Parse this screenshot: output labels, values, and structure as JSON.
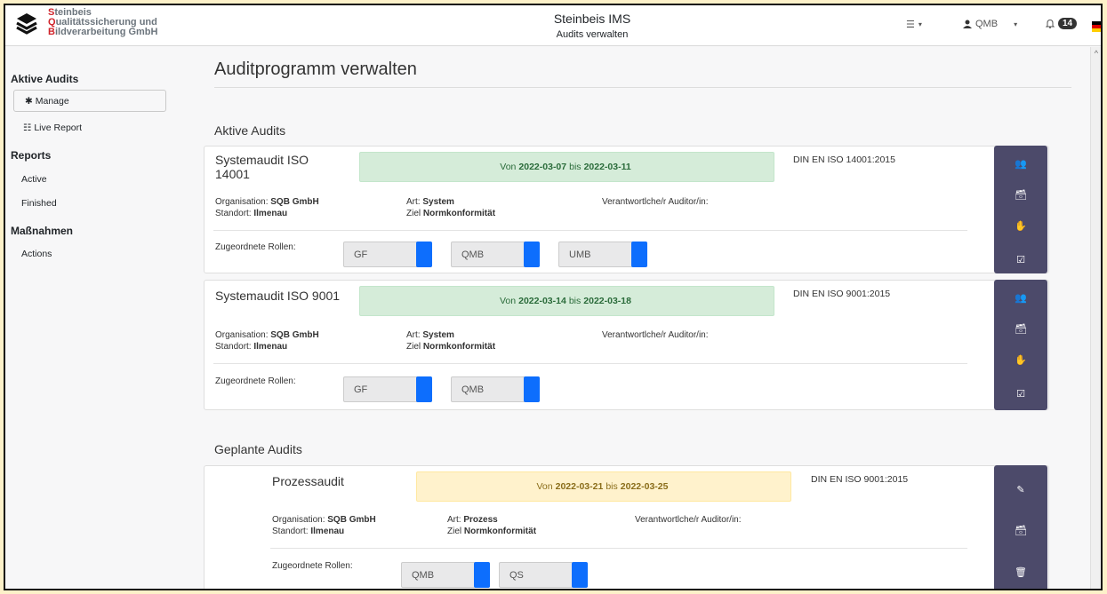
{
  "header": {
    "company_line1_init": "S",
    "company_line1_rest": "teinbeis",
    "company_line2_init": "Q",
    "company_line2_rest": "ualitätssicherung und",
    "company_line3_init": "B",
    "company_line3_rest": "ildverarbeitung GmbH",
    "app_title": "Steinbeis IMS",
    "app_subtitle": "Audits verwalten",
    "user": "QMB",
    "notifications": "14"
  },
  "sidebar": {
    "section1": "Aktive Audits",
    "manage": "Manage",
    "live_report": "Live Report",
    "section2": "Reports",
    "active": "Active",
    "finished": "Finished",
    "section3": "Maßnahmen",
    "actions": "Actions"
  },
  "main": {
    "page_title": "Auditprogramm verwalten",
    "active_title": "Aktive Audits",
    "planned_title": "Geplante Audits",
    "labels": {
      "von": "Von",
      "bis": "bis",
      "org": "Organisation:",
      "standort": "Standort:",
      "art": "Art:",
      "ziel": "Ziel",
      "verantwortlich": "Verantwortlche/r Auditor/in:",
      "roles": "Zugeordnete Rollen:"
    },
    "active_audits": [
      {
        "name": "Systemaudit ISO 14001",
        "from": "2022-03-07",
        "to": "2022-03-11",
        "norm": "DIN EN ISO 14001:2015",
        "org": "SQB GmbH",
        "standort": "Ilmenau",
        "art": "System",
        "ziel": "Normkonformität",
        "roles": [
          "GF",
          "QMB",
          "UMB"
        ]
      },
      {
        "name": "Systemaudit ISO 9001",
        "from": "2022-03-14",
        "to": "2022-03-18",
        "norm": "DIN EN ISO 9001:2015",
        "org": "SQB GmbH",
        "standort": "Ilmenau",
        "art": "System",
        "ziel": "Normkonformität",
        "roles": [
          "GF",
          "QMB"
        ]
      }
    ],
    "planned_audits": [
      {
        "name": "Prozessaudit",
        "from": "2022-03-21",
        "to": "2022-03-25",
        "norm": "DIN EN ISO 9001:2015",
        "org": "SQB GmbH",
        "standort": "Ilmenau",
        "art": "Prozess",
        "ziel": "Normkonformität",
        "roles": [
          "QMB",
          "QS"
        ]
      }
    ]
  },
  "colors": {
    "action_bg": "#4c4a6a",
    "toggle": "#0d6efd",
    "active_period": "#d5ecd9",
    "planned_period": "#fff2cc",
    "brand_red": "#d0242b"
  }
}
